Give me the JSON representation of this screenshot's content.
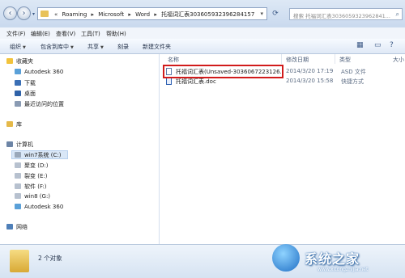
{
  "address_bar": {
    "crumbs": [
      "Roaming",
      "Microsoft",
      "Word",
      "托福词汇表3036059323962841​57"
    ],
    "search_placeholder": "搜索 托福词汇表3036059323962841..."
  },
  "menu": [
    "文件(F)",
    "编辑(E)",
    "查看(V)",
    "工具(T)",
    "帮助(H)"
  ],
  "toolbar": {
    "organize": "组织",
    "include": "包含到库中",
    "share": "共享",
    "burn": "刻录",
    "new_folder": "新建文件夹"
  },
  "sidebar": {
    "favorites": "收藏夹",
    "fav_items": [
      "Autodesk 360",
      "下载",
      "桌面",
      "最近访问的位置"
    ],
    "library": "库",
    "computer": "计算机",
    "drives": [
      "win7系统 (C:)",
      "聚变 (D:)",
      "裂变 (E:)",
      "软件 (F:)",
      "win8 (G:)",
      "Autodesk 360"
    ],
    "network": "网络"
  },
  "columns": {
    "name": "名称",
    "date": "修改日期",
    "type": "类型",
    "size": "大小"
  },
  "files": [
    {
      "name": "托福词汇表(Unsaved-3036067223126...",
      "date": "2014/3/20 17:19",
      "type": "ASD 文件"
    },
    {
      "name": "托福词汇表.doc",
      "date": "2014/3/20 15:58",
      "type": "快捷方式"
    }
  ],
  "status": {
    "count": "2 个对象"
  },
  "watermark": {
    "text": "系统之家",
    "url": "www.xitongzhijia.net"
  },
  "colors": {
    "highlight": "#d11b1b",
    "folder": "#e8c25a"
  }
}
